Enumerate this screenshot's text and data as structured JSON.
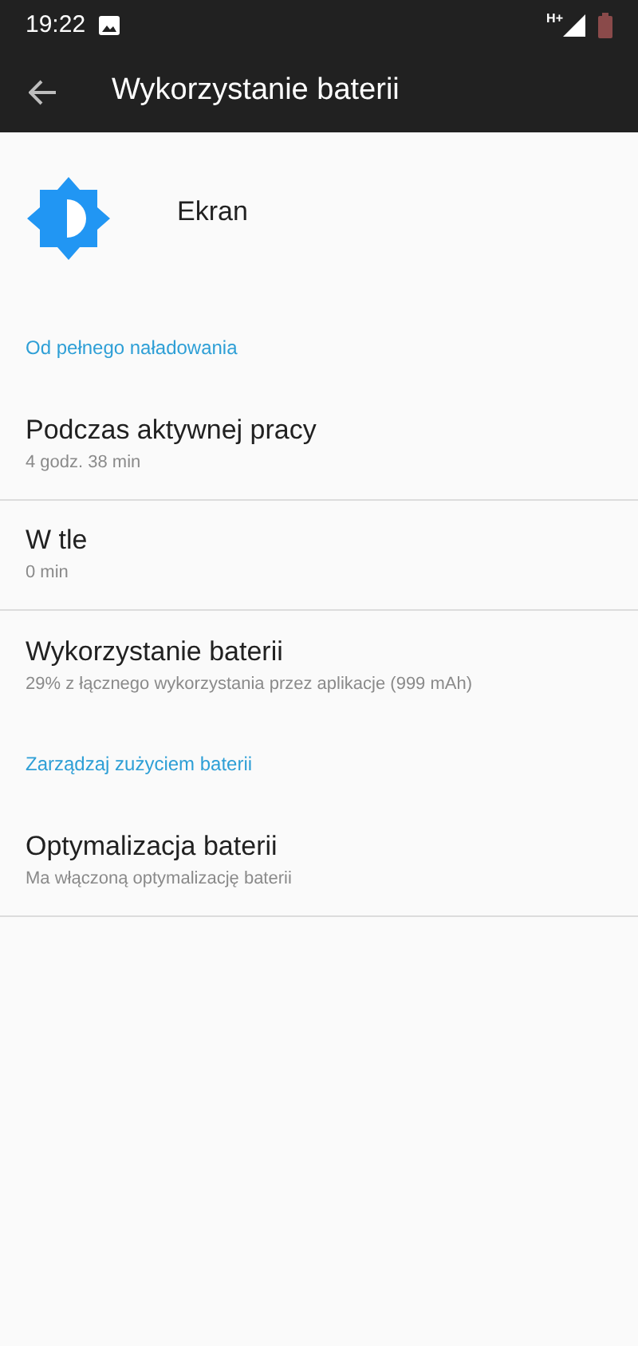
{
  "status_bar": {
    "time": "19:22",
    "network": "H+"
  },
  "toolbar": {
    "title": "Wykorzystanie baterii"
  },
  "header": {
    "title": "Ekran"
  },
  "entries": [
    {
      "kind": "category",
      "label": "Od pełnego naładowania"
    },
    {
      "kind": "item",
      "title": "Podczas aktywnej pracy",
      "summary": "4 godz. 38 min",
      "divider": true
    },
    {
      "kind": "item",
      "title": "W tle",
      "summary": "0 min",
      "divider": true
    },
    {
      "kind": "item",
      "title": "Wykorzystanie baterii",
      "summary": "29% z łącznego wykorzystania przez aplikacje (999 mAh)",
      "divider": false
    },
    {
      "kind": "category",
      "label": "Zarządzaj zużyciem baterii"
    },
    {
      "kind": "item",
      "title": "Optymalizacja baterii",
      "summary": "Ma włączoną optymalizację baterii",
      "divider": true
    }
  ]
}
